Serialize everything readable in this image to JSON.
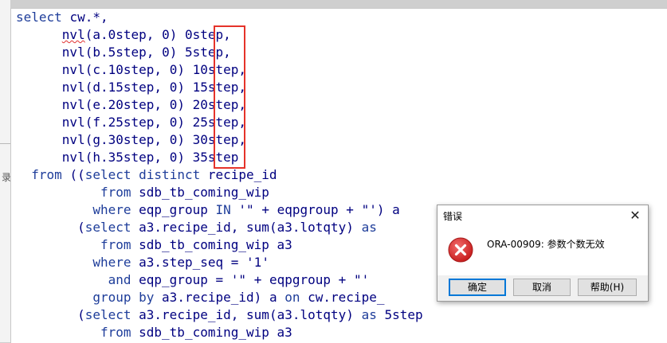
{
  "code": {
    "lines": [
      "select cw.*,",
      "      nvl(a.0step, 0) 0step,",
      "      nvl(b.5step, 0) 5step,",
      "      nvl(c.10step, 0) 10step,",
      "      nvl(d.15step, 0) 15step,",
      "      nvl(e.20step, 0) 20step,",
      "      nvl(f.25step, 0) 25step,",
      "      nvl(g.30step, 0) 30step,",
      "      nvl(h.35step, 0) 35step",
      "  from ((select distinct recipe_id",
      "           from sdb_tb_coming_wip",
      "          where eqp_group IN '\" + eqpgroup + \"') a",
      "        (select a3.recipe_id, sum(a3.lotqty) as",
      "           from sdb_tb_coming_wip a3",
      "          where a3.step_seq = '1'",
      "            and eqp_group = '\" + eqpgroup + \"'",
      "          group by a3.recipe_id) a on cw.recipe_                              in",
      "        (select a3.recipe_id, sum(a3.lotqty) as 5step",
      "           from sdb_tb_coming_wip a3"
    ]
  },
  "dialog": {
    "title": "错误",
    "close_glyph": "✕",
    "message": "ORA-00909: 参数个数无效",
    "ok_label": "确定",
    "cancel_label": "取消",
    "help_label": "帮助(H)",
    "icon": "error-icon"
  },
  "left_strip": {
    "marker": "录"
  },
  "colors": {
    "keyword": "#1e3d9a",
    "highlight_box": "#e5332a",
    "error_icon": "#e02b2b",
    "default_button_border": "#0078d7"
  }
}
